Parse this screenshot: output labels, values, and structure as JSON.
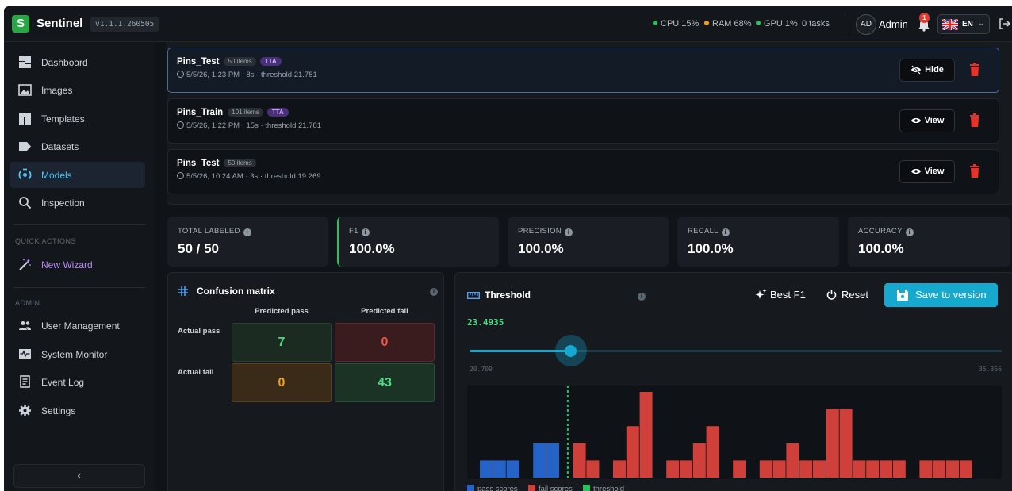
{
  "app": {
    "name": "Sentinel",
    "logo_letter": "S",
    "version": "v1.1.1.260505"
  },
  "status": {
    "cpu": "CPU 15%",
    "ram": "RAM 68%",
    "gpu": "GPU 1%",
    "tasks": "0 tasks",
    "cpu_color": "#2fbf5b",
    "ram_color": "#f0a020",
    "gpu_color": "#2fbf5b"
  },
  "user": {
    "initials": "AD",
    "name": "Admin",
    "notification_count": "1",
    "language": "EN"
  },
  "sidebar": {
    "items": [
      {
        "label": "Dashboard",
        "icon": "dashboard-icon"
      },
      {
        "label": "Images",
        "icon": "image-icon"
      },
      {
        "label": "Templates",
        "icon": "templates-icon"
      },
      {
        "label": "Datasets",
        "icon": "tag-icon"
      },
      {
        "label": "Models",
        "icon": "models-icon"
      },
      {
        "label": "Inspection",
        "icon": "search-icon"
      }
    ],
    "quick_actions_title": "QUICK ACTIONS",
    "wizard_label": "New Wizard",
    "admin_title": "ADMIN",
    "admin_items": [
      {
        "label": "User Management",
        "icon": "users-icon"
      },
      {
        "label": "System Monitor",
        "icon": "monitor-icon"
      },
      {
        "label": "Event Log",
        "icon": "log-icon"
      },
      {
        "label": "Settings",
        "icon": "gear-icon"
      }
    ],
    "collapse_glyph": "‹"
  },
  "runs": [
    {
      "name": "Pins_Test",
      "count": "50 items",
      "tta": "TTA",
      "meta": "5/5/26, 1:23 PM · 8s · threshold 21.781",
      "action": "Hide"
    },
    {
      "name": "Pins_Train",
      "count": "101 items",
      "tta": "TTA",
      "meta": "5/5/26, 1:22 PM · 15s · threshold 21.781",
      "action": "View"
    },
    {
      "name": "Pins_Test",
      "count": "50 items",
      "tta": "",
      "meta": "5/5/26, 10:24 AM · 3s · threshold 19.269",
      "action": "View"
    }
  ],
  "metrics": [
    {
      "label": "TOTAL LABELED",
      "value": "50 / 50"
    },
    {
      "label": "F1",
      "value": "100.0%"
    },
    {
      "label": "PRECISION",
      "value": "100.0%"
    },
    {
      "label": "RECALL",
      "value": "100.0%"
    },
    {
      "label": "ACCURACY",
      "value": "100.0%"
    }
  ],
  "confusion": {
    "title": "Confusion matrix",
    "col_headers": [
      "Predicted pass",
      "Predicted fail"
    ],
    "row_headers": [
      "Actual pass",
      "Actual fail"
    ],
    "values": [
      [
        "7",
        "0"
      ],
      [
        "0",
        "43"
      ]
    ]
  },
  "threshold": {
    "title": "Threshold",
    "value": "23.4935",
    "best_f1_label": "Best F1",
    "reset_label": "Reset",
    "save_label": "Save to version",
    "min_label": "20.709",
    "max_label": "35.366",
    "slider_fraction": 0.19,
    "legend": [
      "pass scores",
      "fail scores",
      "threshold"
    ],
    "colors": {
      "pass": "#2563c9",
      "fail": "#d0403a",
      "threshold": "#22c55e",
      "accent": "#15a9cf"
    }
  },
  "chart_data": {
    "type": "bar",
    "series": [
      {
        "name": "pass scores",
        "values": [
          1,
          1,
          1,
          0,
          2,
          2,
          0,
          0,
          0,
          0,
          0,
          0,
          0,
          0,
          0,
          0,
          0,
          0,
          0,
          0,
          0,
          0,
          0,
          0,
          0,
          0,
          0,
          0,
          0,
          0,
          0,
          0,
          0,
          0,
          0,
          0,
          0,
          0
        ]
      },
      {
        "name": "fail scores",
        "values": [
          0,
          0,
          0,
          0,
          0,
          0,
          0,
          2,
          1,
          0,
          1,
          3,
          5,
          0,
          1,
          1,
          2,
          3,
          0,
          1,
          0,
          1,
          1,
          2,
          1,
          1,
          4,
          4,
          1,
          1,
          1,
          1,
          0,
          1,
          1,
          1,
          1,
          0
        ]
      }
    ],
    "threshold_bin": 6.6,
    "ylim": [
      0,
      5
    ]
  }
}
